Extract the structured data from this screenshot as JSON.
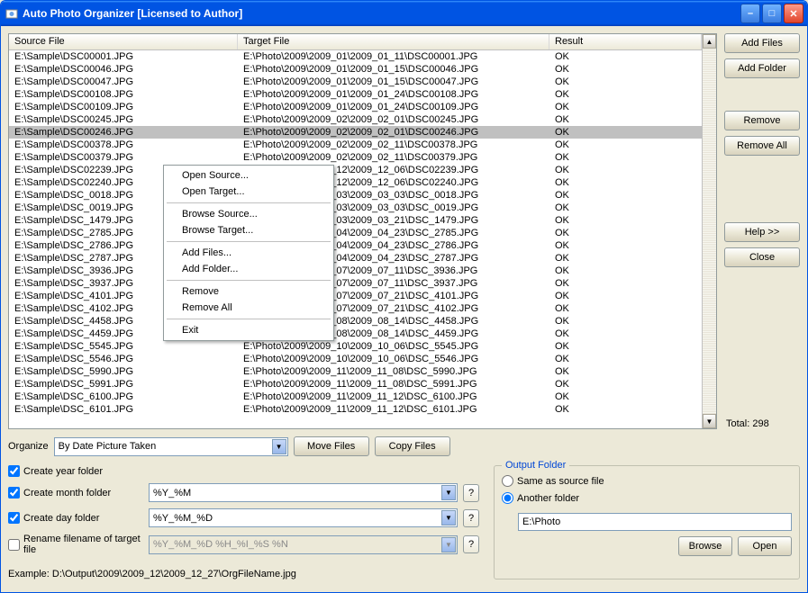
{
  "window": {
    "title": "Auto Photo Organizer [Licensed to Author]"
  },
  "columns": {
    "source": "Source File",
    "target": "Target File",
    "result": "Result"
  },
  "files": [
    {
      "s": "E:\\Sample\\DSC00001.JPG",
      "t": "E:\\Photo\\2009\\2009_01\\2009_01_11\\DSC00001.JPG",
      "r": "OK"
    },
    {
      "s": "E:\\Sample\\DSC00046.JPG",
      "t": "E:\\Photo\\2009\\2009_01\\2009_01_15\\DSC00046.JPG",
      "r": "OK"
    },
    {
      "s": "E:\\Sample\\DSC00047.JPG",
      "t": "E:\\Photo\\2009\\2009_01\\2009_01_15\\DSC00047.JPG",
      "r": "OK"
    },
    {
      "s": "E:\\Sample\\DSC00108.JPG",
      "t": "E:\\Photo\\2009\\2009_01\\2009_01_24\\DSC00108.JPG",
      "r": "OK"
    },
    {
      "s": "E:\\Sample\\DSC00109.JPG",
      "t": "E:\\Photo\\2009\\2009_01\\2009_01_24\\DSC00109.JPG",
      "r": "OK"
    },
    {
      "s": "E:\\Sample\\DSC00245.JPG",
      "t": "E:\\Photo\\2009\\2009_02\\2009_02_01\\DSC00245.JPG",
      "r": "OK"
    },
    {
      "s": "E:\\Sample\\DSC00246.JPG",
      "t": "E:\\Photo\\2009\\2009_02\\2009_02_01\\DSC00246.JPG",
      "r": "OK",
      "sel": true
    },
    {
      "s": "E:\\Sample\\DSC00378.JPG",
      "t": "E:\\Photo\\2009\\2009_02\\2009_02_11\\DSC00378.JPG",
      "r": "OK"
    },
    {
      "s": "E:\\Sample\\DSC00379.JPG",
      "t": "E:\\Photo\\2009\\2009_02\\2009_02_11\\DSC00379.JPG",
      "r": "OK"
    },
    {
      "s": "E:\\Sample\\DSC02239.JPG",
      "t": "E:\\Photo\\2009\\2009_12\\2009_12_06\\DSC02239.JPG",
      "r": "OK"
    },
    {
      "s": "E:\\Sample\\DSC02240.JPG",
      "t": "E:\\Photo\\2009\\2009_12\\2009_12_06\\DSC02240.JPG",
      "r": "OK"
    },
    {
      "s": "E:\\Sample\\DSC_0018.JPG",
      "t": "E:\\Photo\\2009\\2009_03\\2009_03_03\\DSC_0018.JPG",
      "r": "OK"
    },
    {
      "s": "E:\\Sample\\DSC_0019.JPG",
      "t": "E:\\Photo\\2009\\2009_03\\2009_03_03\\DSC_0019.JPG",
      "r": "OK"
    },
    {
      "s": "E:\\Sample\\DSC_1479.JPG",
      "t": "E:\\Photo\\2009\\2009_03\\2009_03_21\\DSC_1479.JPG",
      "r": "OK"
    },
    {
      "s": "E:\\Sample\\DSC_2785.JPG",
      "t": "E:\\Photo\\2009\\2009_04\\2009_04_23\\DSC_2785.JPG",
      "r": "OK"
    },
    {
      "s": "E:\\Sample\\DSC_2786.JPG",
      "t": "E:\\Photo\\2009\\2009_04\\2009_04_23\\DSC_2786.JPG",
      "r": "OK"
    },
    {
      "s": "E:\\Sample\\DSC_2787.JPG",
      "t": "E:\\Photo\\2009\\2009_04\\2009_04_23\\DSC_2787.JPG",
      "r": "OK"
    },
    {
      "s": "E:\\Sample\\DSC_3936.JPG",
      "t": "E:\\Photo\\2009\\2009_07\\2009_07_11\\DSC_3936.JPG",
      "r": "OK"
    },
    {
      "s": "E:\\Sample\\DSC_3937.JPG",
      "t": "E:\\Photo\\2009\\2009_07\\2009_07_11\\DSC_3937.JPG",
      "r": "OK"
    },
    {
      "s": "E:\\Sample\\DSC_4101.JPG",
      "t": "E:\\Photo\\2009\\2009_07\\2009_07_21\\DSC_4101.JPG",
      "r": "OK"
    },
    {
      "s": "E:\\Sample\\DSC_4102.JPG",
      "t": "E:\\Photo\\2009\\2009_07\\2009_07_21\\DSC_4102.JPG",
      "r": "OK"
    },
    {
      "s": "E:\\Sample\\DSC_4458.JPG",
      "t": "E:\\Photo\\2009\\2009_08\\2009_08_14\\DSC_4458.JPG",
      "r": "OK"
    },
    {
      "s": "E:\\Sample\\DSC_4459.JPG",
      "t": "E:\\Photo\\2009\\2009_08\\2009_08_14\\DSC_4459.JPG",
      "r": "OK"
    },
    {
      "s": "E:\\Sample\\DSC_5545.JPG",
      "t": "E:\\Photo\\2009\\2009_10\\2009_10_06\\DSC_5545.JPG",
      "r": "OK"
    },
    {
      "s": "E:\\Sample\\DSC_5546.JPG",
      "t": "E:\\Photo\\2009\\2009_10\\2009_10_06\\DSC_5546.JPG",
      "r": "OK"
    },
    {
      "s": "E:\\Sample\\DSC_5990.JPG",
      "t": "E:\\Photo\\2009\\2009_11\\2009_11_08\\DSC_5990.JPG",
      "r": "OK"
    },
    {
      "s": "E:\\Sample\\DSC_5991.JPG",
      "t": "E:\\Photo\\2009\\2009_11\\2009_11_08\\DSC_5991.JPG",
      "r": "OK"
    },
    {
      "s": "E:\\Sample\\DSC_6100.JPG",
      "t": "E:\\Photo\\2009\\2009_11\\2009_11_12\\DSC_6100.JPG",
      "r": "OK"
    },
    {
      "s": "E:\\Sample\\DSC_6101.JPG",
      "t": "E:\\Photo\\2009\\2009_11\\2009_11_12\\DSC_6101.JPG",
      "r": "OK"
    }
  ],
  "side": {
    "add_files": "Add Files",
    "add_folder": "Add Folder",
    "remove": "Remove",
    "remove_all": "Remove All",
    "help": "Help >>",
    "close": "Close",
    "total": "Total: 298"
  },
  "organize": {
    "label": "Organize",
    "value": "By Date Picture Taken",
    "move": "Move Files",
    "copy": "Copy Files"
  },
  "opts": {
    "year": "Create year folder",
    "month": "Create month folder",
    "month_fmt": "%Y_%M",
    "day": "Create day folder",
    "day_fmt": "%Y_%M_%D",
    "rename": "Rename filename of target file",
    "rename_fmt": "%Y_%M_%D %H_%I_%S %N",
    "q": "?"
  },
  "output": {
    "group": "Output Folder",
    "same": "Same as source file",
    "another": "Another folder",
    "path": "E:\\Photo",
    "browse": "Browse",
    "open": "Open"
  },
  "example": "Example: D:\\Output\\2009\\2009_12\\2009_12_27\\OrgFileName.jpg",
  "menu": {
    "open_source": "Open Source...",
    "open_target": "Open Target...",
    "browse_source": "Browse Source...",
    "browse_target": "Browse Target...",
    "add_files": "Add Files...",
    "add_folder": "Add Folder...",
    "remove": "Remove",
    "remove_all": "Remove All",
    "exit": "Exit"
  }
}
